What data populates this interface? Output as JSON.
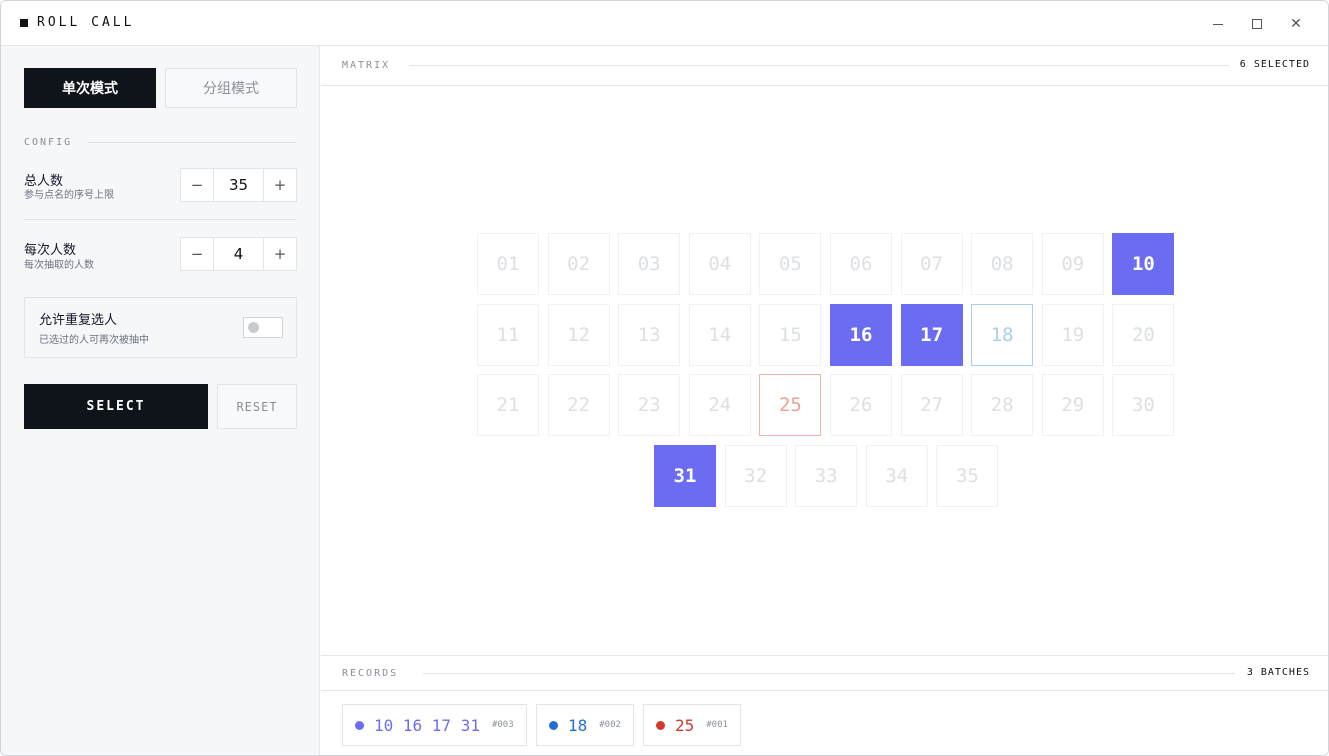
{
  "window": {
    "title": "ROLL CALL"
  },
  "sidebar": {
    "modes": [
      "单次模式",
      "分组模式"
    ],
    "config_label": "CONFIG",
    "total": {
      "title": "总人数",
      "subtitle": "参与点名的序号上限",
      "value": "35",
      "minus": "−",
      "plus": "+"
    },
    "per_draw": {
      "title": "每次人数",
      "subtitle": "每次抽取的人数",
      "value": "4",
      "minus": "−",
      "plus": "+"
    },
    "repeat": {
      "title": "允许重复选人",
      "subtitle": "已选过的人可再次被抽中",
      "enabled": false
    },
    "select_label": "SELECT",
    "reset_label": "RESET"
  },
  "matrix": {
    "label": "MATRIX",
    "count": "6 SELECTED",
    "cells": [
      "01",
      "02",
      "03",
      "04",
      "05",
      "06",
      "07",
      "08",
      "09",
      "10",
      "11",
      "12",
      "13",
      "14",
      "15",
      "16",
      "17",
      "18",
      "19",
      "20",
      "21",
      "22",
      "23",
      "24",
      "25",
      "26",
      "27",
      "28",
      "29",
      "30",
      "31",
      "32",
      "33",
      "34",
      "35"
    ],
    "highlight_purple": [
      "10",
      "16",
      "17",
      "31"
    ],
    "highlight_blue": [
      "18"
    ],
    "highlight_red": [
      "25"
    ]
  },
  "records": {
    "label": "RECORDS",
    "count": "3 BATCHES",
    "items": [
      {
        "numbers": "10 16 17 31",
        "id": "#003",
        "color": "#6c6cf2"
      },
      {
        "numbers": "18",
        "id": "#002",
        "color": "#1f6fd6"
      },
      {
        "numbers": "25",
        "id": "#001",
        "color": "#d33a2c"
      }
    ]
  },
  "colors": {
    "accent": "#6c6cf2",
    "dark": "#0f141b",
    "blue": "#1f6fd6",
    "red": "#d33a2c"
  }
}
